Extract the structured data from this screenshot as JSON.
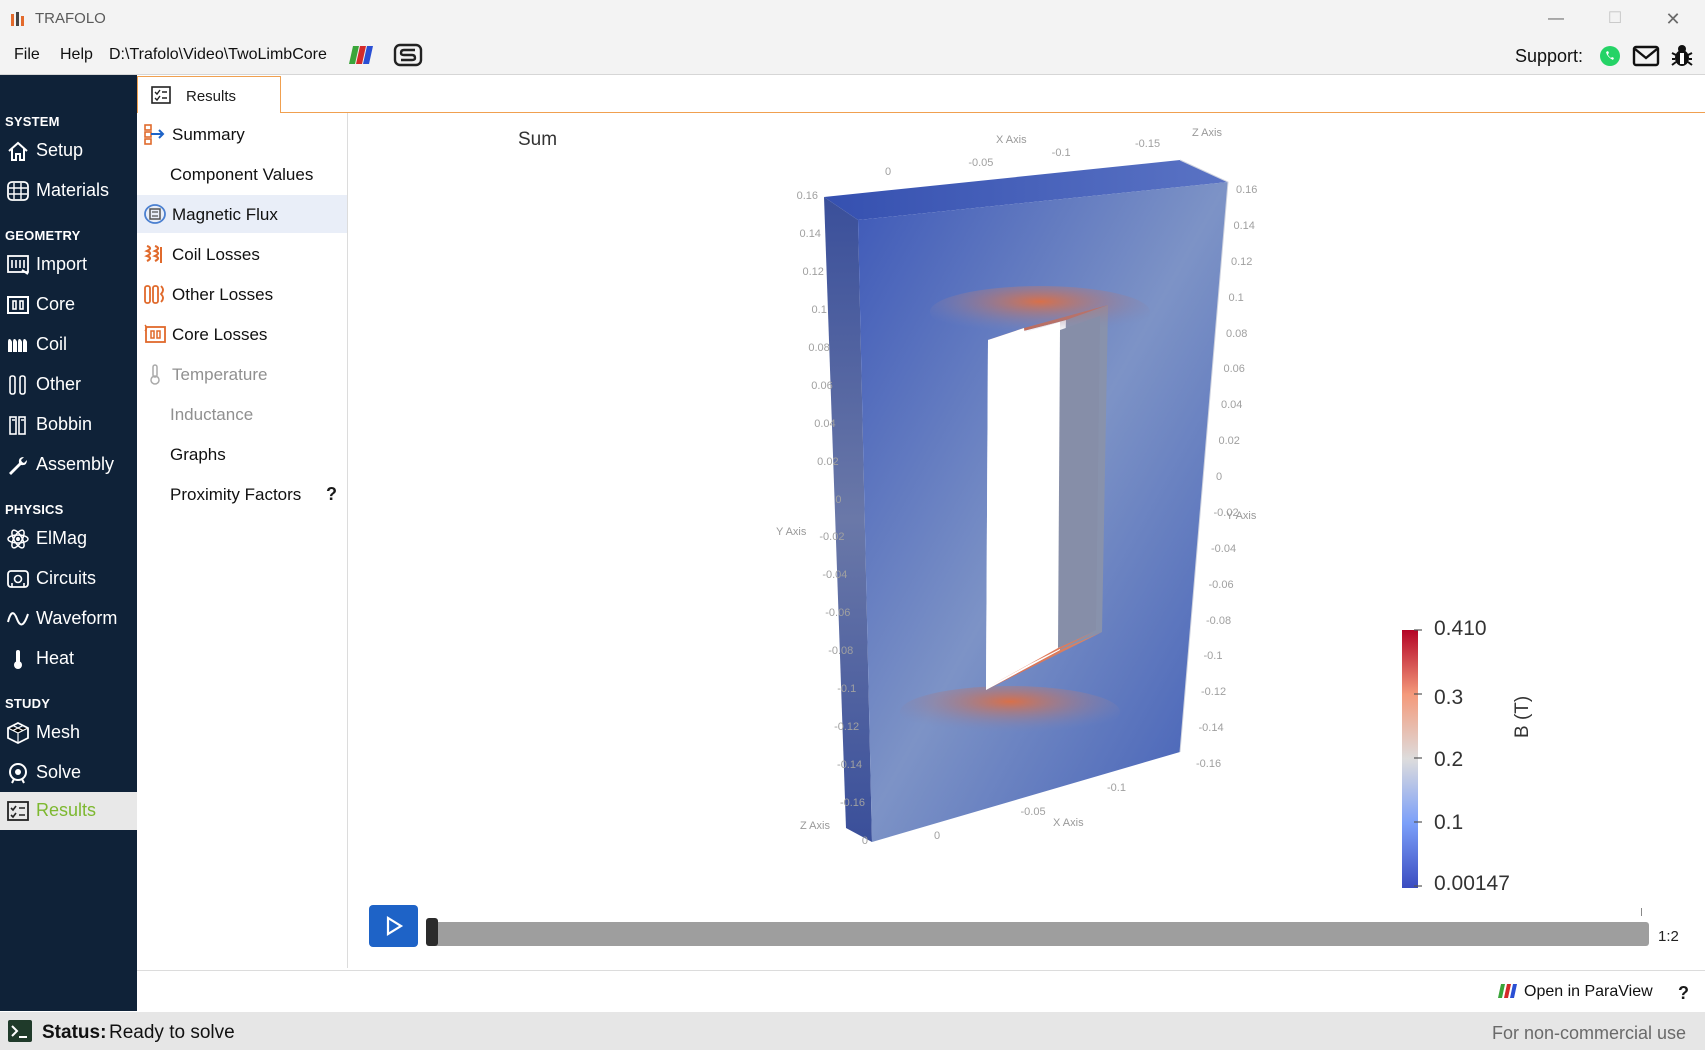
{
  "app": {
    "title": "TRAFOLO"
  },
  "window_controls": {
    "minimize": "—",
    "maximize": "☐",
    "close": "✕"
  },
  "menu": {
    "file": "File",
    "help": "Help",
    "path": "D:\\Trafolo\\Video\\TwoLimbCore"
  },
  "support": {
    "label": "Support:"
  },
  "sidebar": {
    "sections": {
      "system": "SYSTEM",
      "geometry": "GEOMETRY",
      "physics": "PHYSICS",
      "study": "STUDY"
    },
    "items": [
      {
        "label": "Setup",
        "icon": "home-icon"
      },
      {
        "label": "Materials",
        "icon": "materials-icon"
      },
      {
        "label": "Import",
        "icon": "import-icon"
      },
      {
        "label": "Core",
        "icon": "core-icon"
      },
      {
        "label": "Coil",
        "icon": "coil-icon"
      },
      {
        "label": "Other",
        "icon": "other-icon"
      },
      {
        "label": "Bobbin",
        "icon": "bobbin-icon"
      },
      {
        "label": "Assembly",
        "icon": "wrench-icon"
      },
      {
        "label": "ElMag",
        "icon": "atom-icon"
      },
      {
        "label": "Circuits",
        "icon": "circuit-icon"
      },
      {
        "label": "Waveform",
        "icon": "wave-icon"
      },
      {
        "label": "Heat",
        "icon": "thermometer-icon"
      },
      {
        "label": "Mesh",
        "icon": "mesh-icon"
      },
      {
        "label": "Solve",
        "icon": "solve-icon"
      },
      {
        "label": "Results",
        "icon": "results-icon"
      }
    ]
  },
  "tab": {
    "label": "Results"
  },
  "results_menu": {
    "items": [
      {
        "label": "Summary"
      },
      {
        "label": "Component Values"
      },
      {
        "label": "Magnetic Flux"
      },
      {
        "label": "Coil Losses"
      },
      {
        "label": "Other Losses"
      },
      {
        "label": "Core Losses"
      },
      {
        "label": "Temperature"
      },
      {
        "label": "Inductance"
      },
      {
        "label": "Graphs"
      },
      {
        "label": "Proximity Factors"
      }
    ],
    "help": "?"
  },
  "view": {
    "title": "Sum",
    "axes": {
      "x": "X Axis",
      "y": "Y Axis",
      "z": "Z Axis"
    },
    "left_ticks": [
      "0.16",
      "0.14",
      "0.12",
      "0.1",
      "0.08",
      "0.06",
      "0.04",
      "0.02",
      "0",
      "-0.02",
      "-0.04",
      "-0.06",
      "-0.08",
      "-0.1",
      "-0.12",
      "-0.14",
      "-0.16",
      "0"
    ],
    "right_ticks": [
      "0.16",
      "0.14",
      "0.12",
      "0.1",
      "0.08",
      "0.06",
      "0.04",
      "0.02",
      "0",
      "-0.02",
      "-0.04",
      "-0.06",
      "-0.08",
      "-0.1",
      "-0.12",
      "-0.14",
      "-0.16"
    ],
    "top_ticks": [
      "0",
      "-0.05",
      "-0.1",
      "-0.15"
    ],
    "bottom_ticks": [
      "0",
      "-0.05",
      "-0.1"
    ],
    "colorbar": {
      "title": "B (T)",
      "labels": [
        "0.410",
        "0.3",
        "0.2",
        "0.1",
        "0.00147"
      ],
      "min": 0.00147,
      "max": 0.41
    }
  },
  "animation": {
    "frame": "1:2",
    "progress": 0
  },
  "paraview": {
    "label": "Open in ParaView",
    "help": "?"
  },
  "status": {
    "key": "Status:",
    "value": "Ready to solve",
    "license": "For non-commercial use"
  },
  "colors": {
    "sidebar": "#0f2238",
    "accent": "#f0a050",
    "results_green": "#7db830",
    "play": "#1e63c7"
  }
}
